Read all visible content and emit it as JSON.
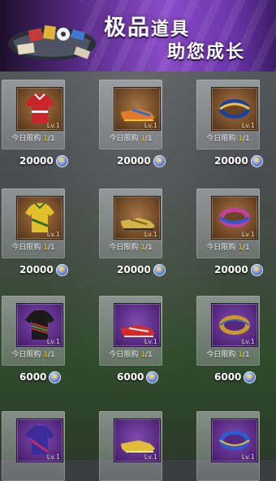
{
  "banner": {
    "title_large": "极品",
    "title_small": "道具",
    "subtitle": "助您成长"
  },
  "limit_prefix": "今日限购",
  "items": [
    {
      "name": "red-jersey",
      "thumb": "brown",
      "level": "Lv.1",
      "bought": "1",
      "limit": "/1",
      "price": "20000",
      "icon": "red-jersey-icon"
    },
    {
      "name": "orange-boots",
      "thumb": "brown",
      "level": "Lv.1",
      "bought": "1",
      "limit": "/1",
      "price": "20000",
      "icon": "orange-boots-icon"
    },
    {
      "name": "blue-yellow-wristband",
      "thumb": "brown",
      "level": "Lv.1",
      "bought": "1",
      "limit": "/1",
      "price": "20000",
      "icon": "wristband-icon"
    },
    {
      "name": "yellow-jersey",
      "thumb": "brown",
      "level": "Lv.1",
      "bought": "1",
      "limit": "/1",
      "price": "20000",
      "icon": "yellow-jersey-icon"
    },
    {
      "name": "gold-boots",
      "thumb": "brown",
      "level": "Lv.1",
      "bought": "1",
      "limit": "/1",
      "price": "20000",
      "icon": "gold-boots-icon"
    },
    {
      "name": "pink-blue-wristband",
      "thumb": "brown",
      "level": "Lv.1",
      "bought": "1",
      "limit": "/1",
      "price": "20000",
      "icon": "wristband-icon"
    },
    {
      "name": "black-striped-jersey",
      "thumb": "purple",
      "level": "Lv.1",
      "bought": "1",
      "limit": "/1",
      "price": "6000",
      "icon": "striped-jersey-icon"
    },
    {
      "name": "red-boots",
      "thumb": "purple",
      "level": "Lv.1",
      "bought": "1",
      "limit": "/1",
      "price": "6000",
      "icon": "red-boots-icon"
    },
    {
      "name": "gold-wristband",
      "thumb": "purple",
      "level": "Lv.1",
      "bought": "1",
      "limit": "/1",
      "price": "6000",
      "icon": "wristband-icon"
    },
    {
      "name": "purple-jersey",
      "thumb": "purple",
      "level": "Lv.1",
      "icon": "purple-jersey-icon"
    },
    {
      "name": "gold-cleats",
      "thumb": "purple",
      "level": "Lv.1",
      "icon": "gold-cleats-icon"
    },
    {
      "name": "blue-wristband",
      "thumb": "purple",
      "level": "Lv.1",
      "icon": "wristband-icon"
    }
  ],
  "colors": {
    "banner_accent": "#8a4bc8",
    "limit_highlight": "#f6c63a",
    "coin": "#6d86c9"
  }
}
